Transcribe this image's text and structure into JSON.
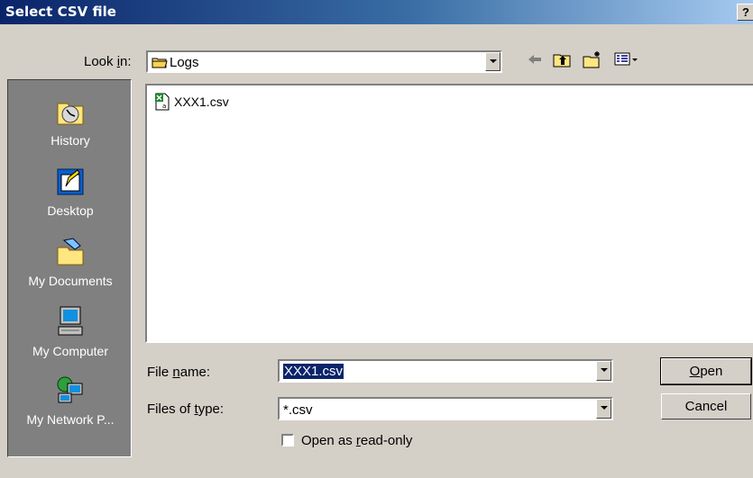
{
  "window": {
    "title": "Select CSV file",
    "help_label": "?"
  },
  "lookin": {
    "label_pre": "Look ",
    "label_acc": "i",
    "label_post": "n:",
    "value": "Logs"
  },
  "toolbar": {
    "back_icon": "back-arrow-icon",
    "up_icon": "up-folder-icon",
    "new_folder_icon": "new-folder-icon",
    "view_icon": "view-menu-icon"
  },
  "places": [
    {
      "label": "History",
      "icon": "history-icon"
    },
    {
      "label": "Desktop",
      "icon": "desktop-icon"
    },
    {
      "label": "My Documents",
      "icon": "my-documents-icon"
    },
    {
      "label": "My Computer",
      "icon": "my-computer-icon"
    },
    {
      "label": "My Network P...",
      "icon": "network-places-icon"
    }
  ],
  "files": [
    {
      "name": "XXX1.csv",
      "icon": "csv-file-icon"
    }
  ],
  "filename": {
    "label_pre": "File ",
    "label_acc": "n",
    "label_post": "ame:",
    "value": "XXX1.csv"
  },
  "filetype": {
    "label_pre": "Files of ",
    "label_acc": "t",
    "label_post": "ype:",
    "value": "*.csv"
  },
  "readonly": {
    "label_pre": "Open as ",
    "label_acc": "r",
    "label_post": "ead-only"
  },
  "buttons": {
    "open_acc": "O",
    "open_rest": "pen",
    "cancel": "Cancel"
  }
}
